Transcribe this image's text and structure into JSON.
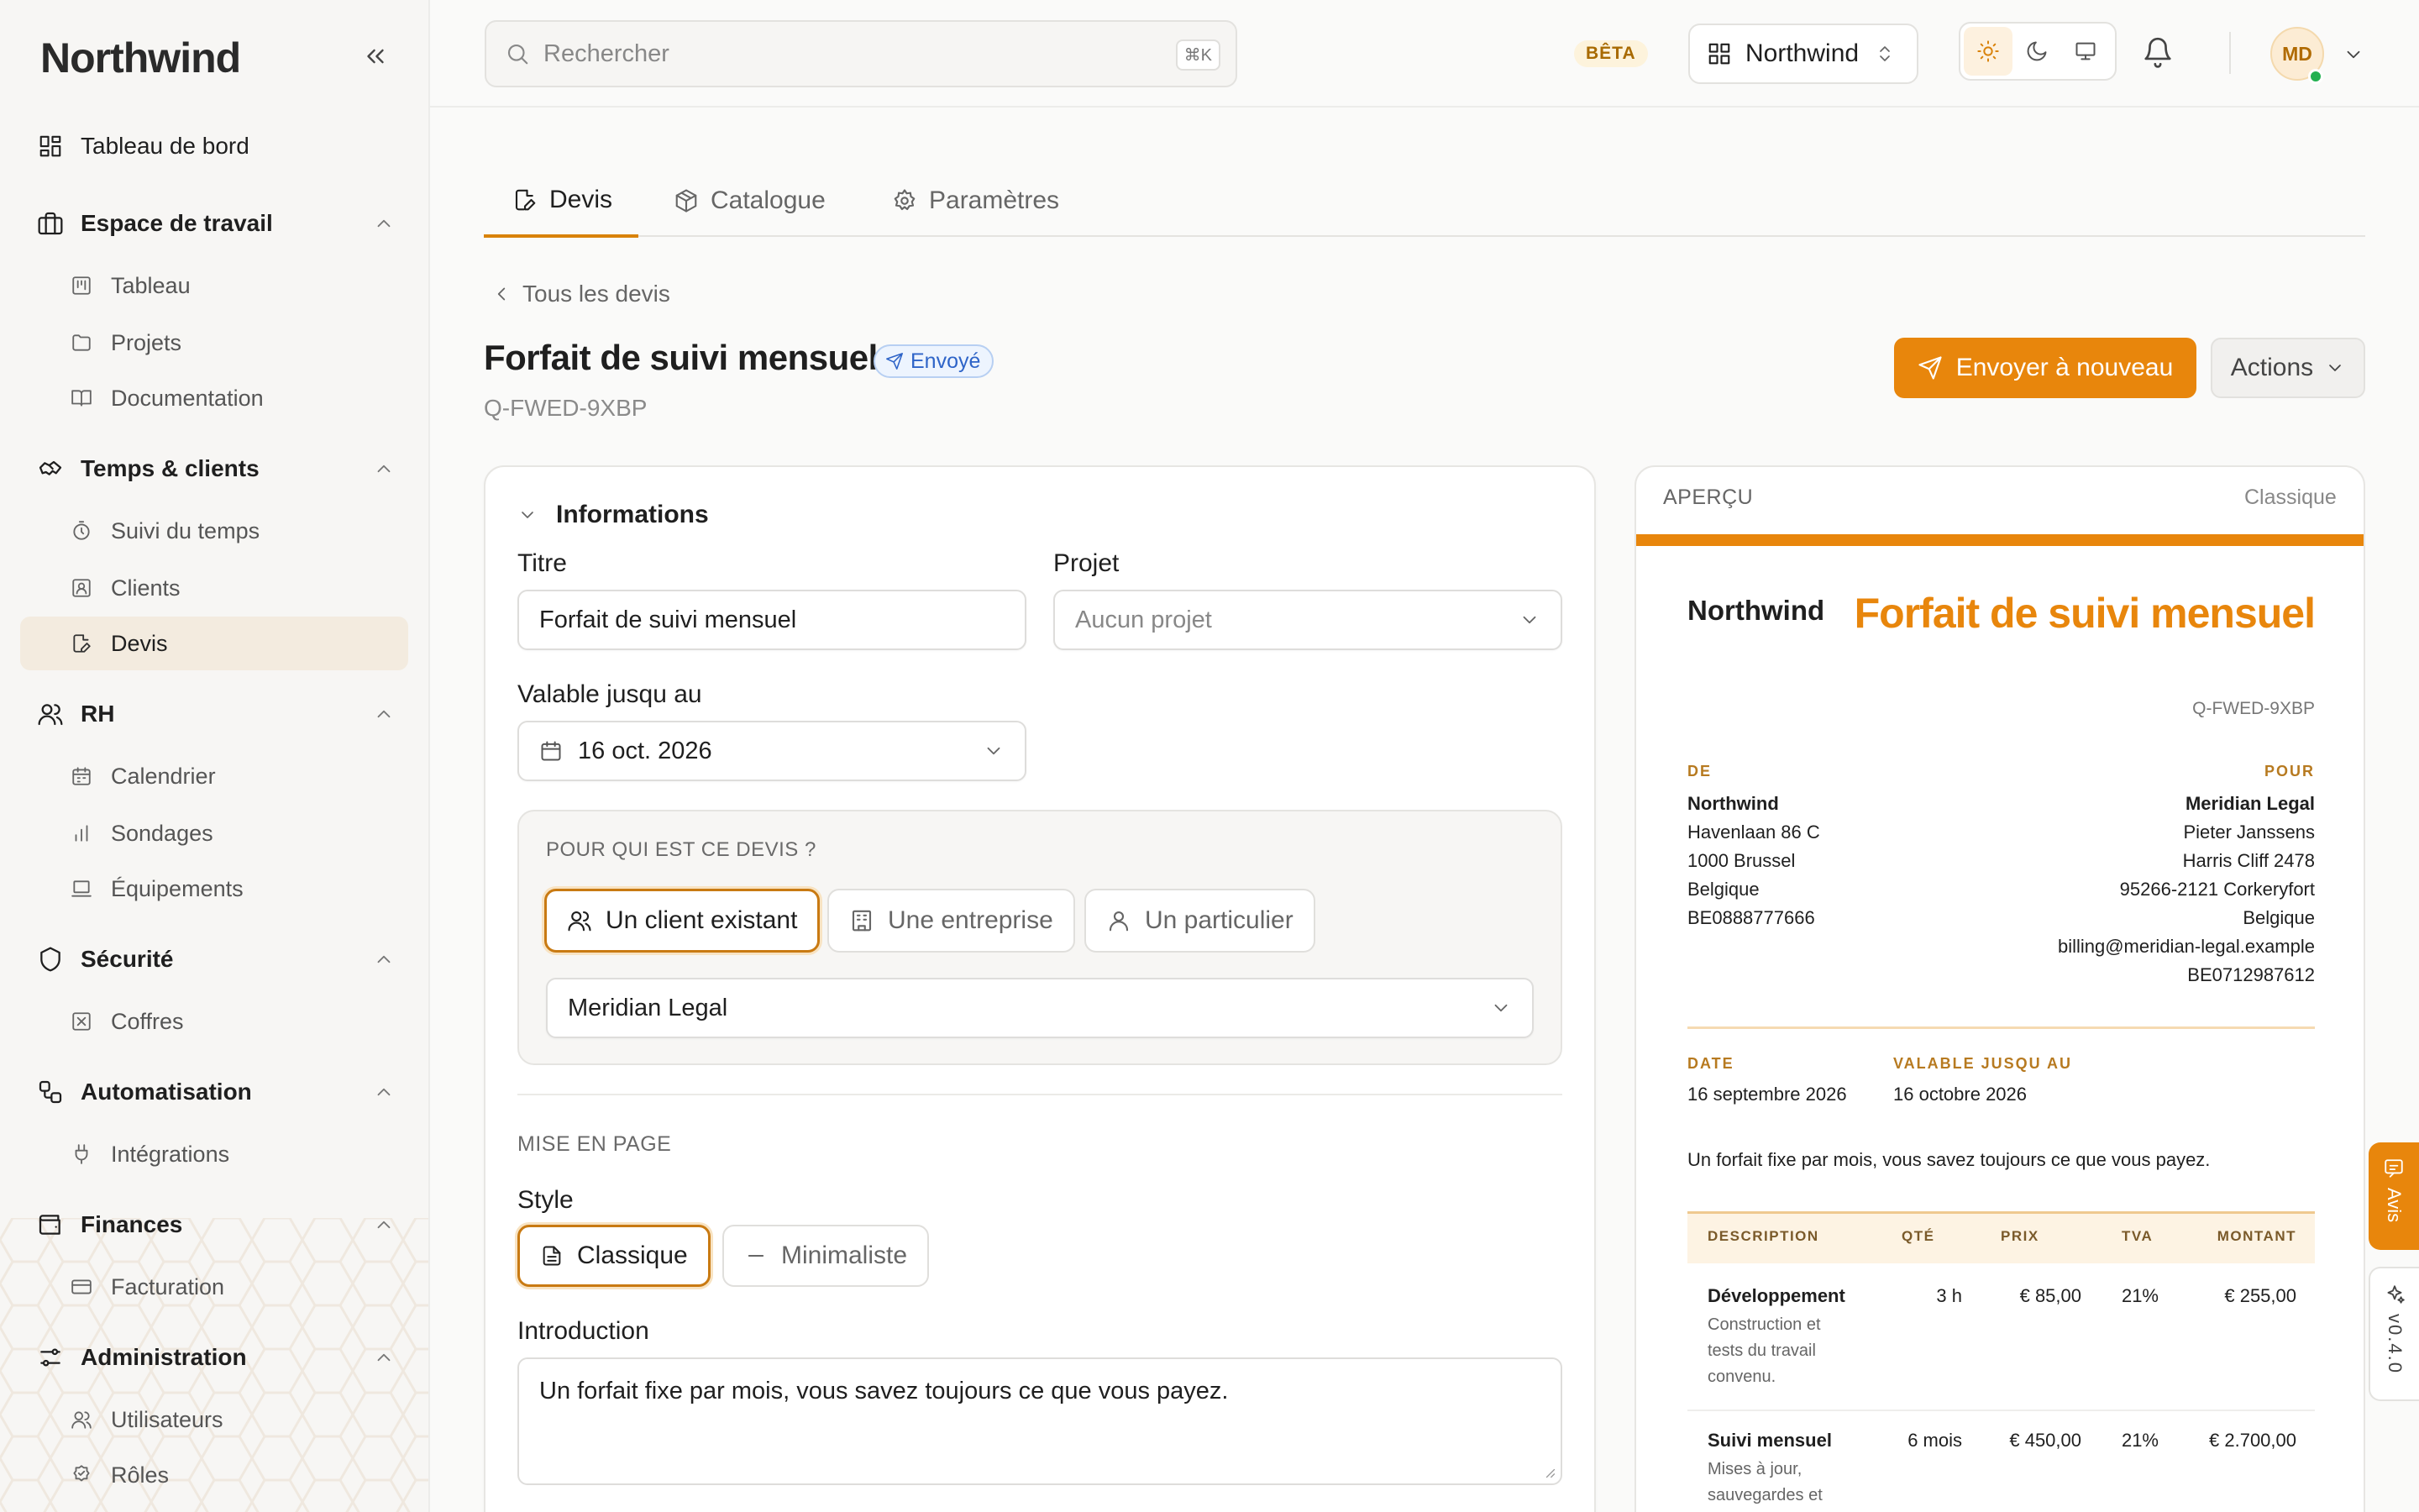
{
  "app": {
    "brand": "Northwind"
  },
  "sidebar": {
    "dashboard": "Tableau de bord",
    "groups": [
      {
        "label": "Espace de travail",
        "items": [
          "Tableau",
          "Projets",
          "Documentation"
        ]
      },
      {
        "label": "Temps & clients",
        "items": [
          "Suivi du temps",
          "Clients",
          "Devis"
        ]
      },
      {
        "label": "RH",
        "items": [
          "Calendrier",
          "Sondages",
          "Équipements"
        ]
      },
      {
        "label": "Sécurité",
        "items": [
          "Coffres"
        ]
      },
      {
        "label": "Automatisation",
        "items": [
          "Intégrations"
        ]
      },
      {
        "label": "Finances",
        "items": [
          "Facturation"
        ]
      },
      {
        "label": "Administration",
        "items": [
          "Utilisateurs",
          "Rôles"
        ]
      }
    ],
    "active_item": "Devis"
  },
  "topbar": {
    "search_placeholder": "Rechercher",
    "search_shortcut": "⌘K",
    "beta": "BÊTA",
    "org": "Northwind",
    "avatar_initials": "MD"
  },
  "tabs": [
    {
      "label": "Devis",
      "active": true
    },
    {
      "label": "Catalogue",
      "active": false
    },
    {
      "label": "Paramètres",
      "active": false
    }
  ],
  "page": {
    "back": "Tous les devis",
    "title": "Forfait de suivi mensuel",
    "status": "Envoyé",
    "ref": "Q-FWED-9XBP",
    "resend": "Envoyer à nouveau",
    "actions": "Actions"
  },
  "form": {
    "section": "Informations",
    "title_label": "Titre",
    "title_value": "Forfait de suivi mensuel",
    "project_label": "Projet",
    "project_value": "Aucun projet",
    "valid_label": "Valable jusqu au",
    "valid_value": "16 oct. 2026",
    "who_label": "POUR QUI EST CE DEVIS ?",
    "who_options": [
      "Un client existant",
      "Une entreprise",
      "Un particulier"
    ],
    "who_selected": "Un client existant",
    "client_value": "Meridian Legal",
    "layout_label": "MISE EN PAGE",
    "style_label": "Style",
    "style_options": [
      "Classique",
      "Minimaliste"
    ],
    "style_selected": "Classique",
    "intro_label": "Introduction",
    "intro_value": "Un forfait fixe par mois, vous savez toujours ce que vous payez."
  },
  "preview": {
    "header": "APERÇU",
    "style": "Classique",
    "brand": "Northwind",
    "title": "Forfait de suivi mensuel",
    "ref": "Q-FWED-9XBP",
    "from_label": "DE",
    "from_lines": [
      "Northwind",
      "Havenlaan 86 C",
      "1000 Brussel",
      "Belgique",
      "BE0888777666"
    ],
    "to_label": "POUR",
    "to_lines": [
      "Meridian Legal",
      "Pieter Janssens",
      "Harris Cliff 2478",
      "95266-2121 Corkeryfort",
      "Belgique",
      "billing@meridian-legal.example",
      "BE0712987612"
    ],
    "date_label": "DATE",
    "date_value": "16 septembre 2026",
    "valid_label": "VALABLE JUSQU AU",
    "valid_value": "16 octobre 2026",
    "intro": "Un forfait fixe par mois, vous savez toujours ce que vous payez.",
    "columns": [
      "DESCRIPTION",
      "QTÉ",
      "PRIX",
      "TVA",
      "MONTANT"
    ],
    "rows": [
      {
        "name": "Développement",
        "desc": [
          "Construction et",
          "tests du travail",
          "convenu."
        ],
        "qty": "3 h",
        "price": "€ 85,00",
        "vat": "21%",
        "amount": "€ 255,00"
      },
      {
        "name": "Suivi mensuel",
        "desc": [
          "Mises à jour,",
          "sauvegardes et"
        ],
        "qty": "6 mois",
        "price": "€ 450,00",
        "vat": "21%",
        "amount": "€ 2.700,00"
      }
    ]
  },
  "floating": {
    "feedback": "Avis",
    "version": "v0.4.0"
  },
  "colors": {
    "accent": "#e8860c",
    "status_blue": "#2e64c8",
    "online": "#22b050"
  }
}
